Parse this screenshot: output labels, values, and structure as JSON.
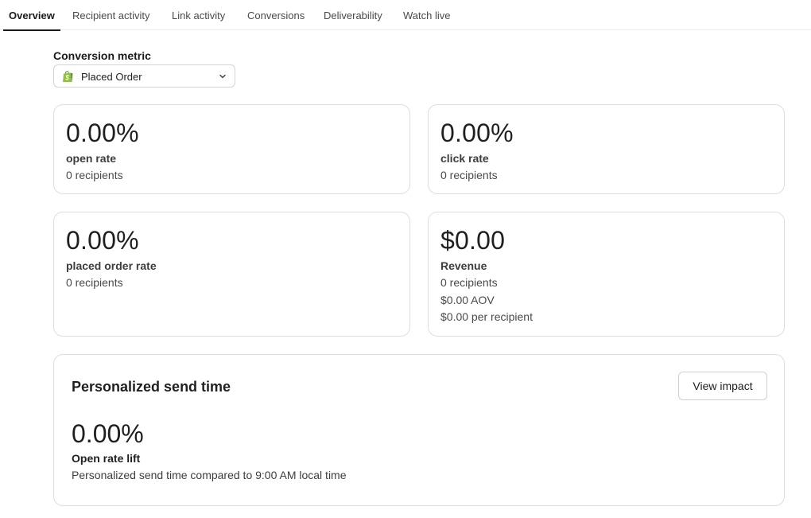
{
  "tabs": [
    {
      "label": "Overview",
      "active": true
    },
    {
      "label": "Recipient activity",
      "active": false
    },
    {
      "label": "Link activity",
      "active": false
    },
    {
      "label": "Conversions",
      "active": false
    },
    {
      "label": "Deliverability",
      "active": false
    },
    {
      "label": "Watch live",
      "active": false
    }
  ],
  "conversion_metric": {
    "label": "Conversion metric",
    "selected": "Placed Order",
    "icon": "shopify-bag-icon"
  },
  "cards": {
    "open_rate": {
      "value": "0.00%",
      "label": "open rate",
      "recipients": "0 recipients"
    },
    "click_rate": {
      "value": "0.00%",
      "label": "click rate",
      "recipients": "0 recipients"
    },
    "placed_order_rate": {
      "value": "0.00%",
      "label": "placed order rate",
      "recipients": "0 recipients"
    },
    "revenue": {
      "value": "$0.00",
      "label": "Revenue",
      "recipients": "0 recipients",
      "aov": "$0.00 AOV",
      "per_recipient": "$0.00 per recipient"
    }
  },
  "personalized_send_time": {
    "title": "Personalized send time",
    "button_label": "View impact",
    "value": "0.00%",
    "label": "Open rate lift",
    "description": "Personalized send time compared to 9:00 AM local time"
  },
  "colors": {
    "shopify_green": "#95bf47",
    "shopify_dark_green": "#5e8e3e",
    "border": "#dedede",
    "text": "#1f1f1f"
  }
}
